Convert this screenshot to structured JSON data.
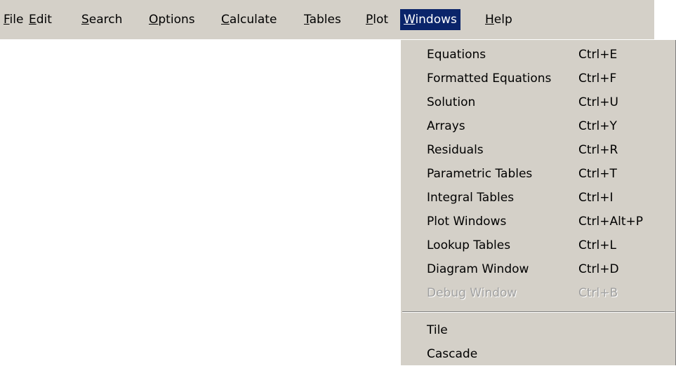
{
  "menubar": {
    "items": [
      {
        "mnemonic": "F",
        "rest": "ile"
      },
      {
        "mnemonic": "E",
        "rest": "dit"
      },
      {
        "mnemonic": "S",
        "rest": "earch"
      },
      {
        "mnemonic": "O",
        "rest": "ptions"
      },
      {
        "mnemonic": "C",
        "rest": "alculate"
      },
      {
        "mnemonic": "T",
        "rest": "ables"
      },
      {
        "mnemonic": "P",
        "rest": "lot"
      },
      {
        "mnemonic": "W",
        "rest": "indows"
      },
      {
        "mnemonic": "H",
        "rest": "elp"
      }
    ],
    "active_item": "Windows"
  },
  "windows_menu": {
    "items": [
      {
        "label": "Equations",
        "shortcut": "Ctrl+E",
        "enabled": true
      },
      {
        "label": "Formatted Equations",
        "shortcut": "Ctrl+F",
        "enabled": true
      },
      {
        "label": "Solution",
        "shortcut": "Ctrl+U",
        "enabled": true
      },
      {
        "label": "Arrays",
        "shortcut": "Ctrl+Y",
        "enabled": true
      },
      {
        "label": "Residuals",
        "shortcut": "Ctrl+R",
        "enabled": true
      },
      {
        "label": "Parametric Tables",
        "shortcut": "Ctrl+T",
        "enabled": true
      },
      {
        "label": "Integral Tables",
        "shortcut": "Ctrl+I",
        "enabled": true
      },
      {
        "label": "Plot Windows",
        "shortcut": "Ctrl+Alt+P",
        "enabled": true
      },
      {
        "label": "Lookup Tables",
        "shortcut": "Ctrl+L",
        "enabled": true
      },
      {
        "label": "Diagram Window",
        "shortcut": "Ctrl+D",
        "enabled": true
      },
      {
        "label": "Debug Window",
        "shortcut": "Ctrl+B",
        "enabled": false
      },
      {
        "label": "Tile",
        "shortcut": "",
        "enabled": true
      },
      {
        "label": "Cascade",
        "shortcut": "",
        "enabled": true
      }
    ]
  },
  "colors": {
    "menu_background": "#d4d0c8",
    "highlight": "#0a246a",
    "highlight_text": "#ffffff",
    "disabled_text": "#a0a0a0"
  }
}
